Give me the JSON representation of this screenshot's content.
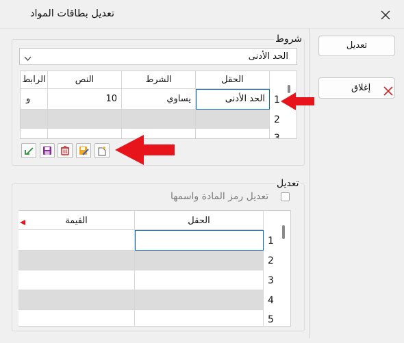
{
  "window": {
    "title": "تعديل بطاقات المواد"
  },
  "buttons": {
    "edit_label": "تعديل",
    "close_label": "إغلاق"
  },
  "conditions": {
    "legend": "شروط",
    "field_select_value": "الحد الأدنى",
    "grid": {
      "headers": [
        "الحقل",
        "الشرط",
        "النص",
        "الرابط"
      ],
      "rows": [
        {
          "num": "1",
          "field": "الحد الأدنى",
          "condition": "يساوي",
          "text": "10",
          "link": "و"
        },
        {
          "num": "2",
          "field": "",
          "condition": "",
          "text": "",
          "link": ""
        },
        {
          "num": "3",
          "field": "",
          "condition": "",
          "text": "",
          "link": ""
        }
      ]
    },
    "toolbar": [
      "undo-icon",
      "save-icon",
      "delete-icon",
      "edit-icon",
      "new-icon"
    ]
  },
  "modify": {
    "legend": "تعديل",
    "checkbox_label": "تعديل رمز المادة واسمها",
    "checkbox_checked": false,
    "grid": {
      "headers": [
        "الحقل",
        "القيمة"
      ],
      "rows": [
        {
          "num": "1",
          "field": "",
          "value": ""
        },
        {
          "num": "2",
          "field": "",
          "value": ""
        },
        {
          "num": "3",
          "field": "",
          "value": ""
        },
        {
          "num": "4",
          "field": "",
          "value": ""
        },
        {
          "num": "5",
          "field": "",
          "value": ""
        }
      ]
    }
  },
  "colors": {
    "accent": "#0067c0",
    "arrow": "#e8141b",
    "delete": "#d22020"
  }
}
